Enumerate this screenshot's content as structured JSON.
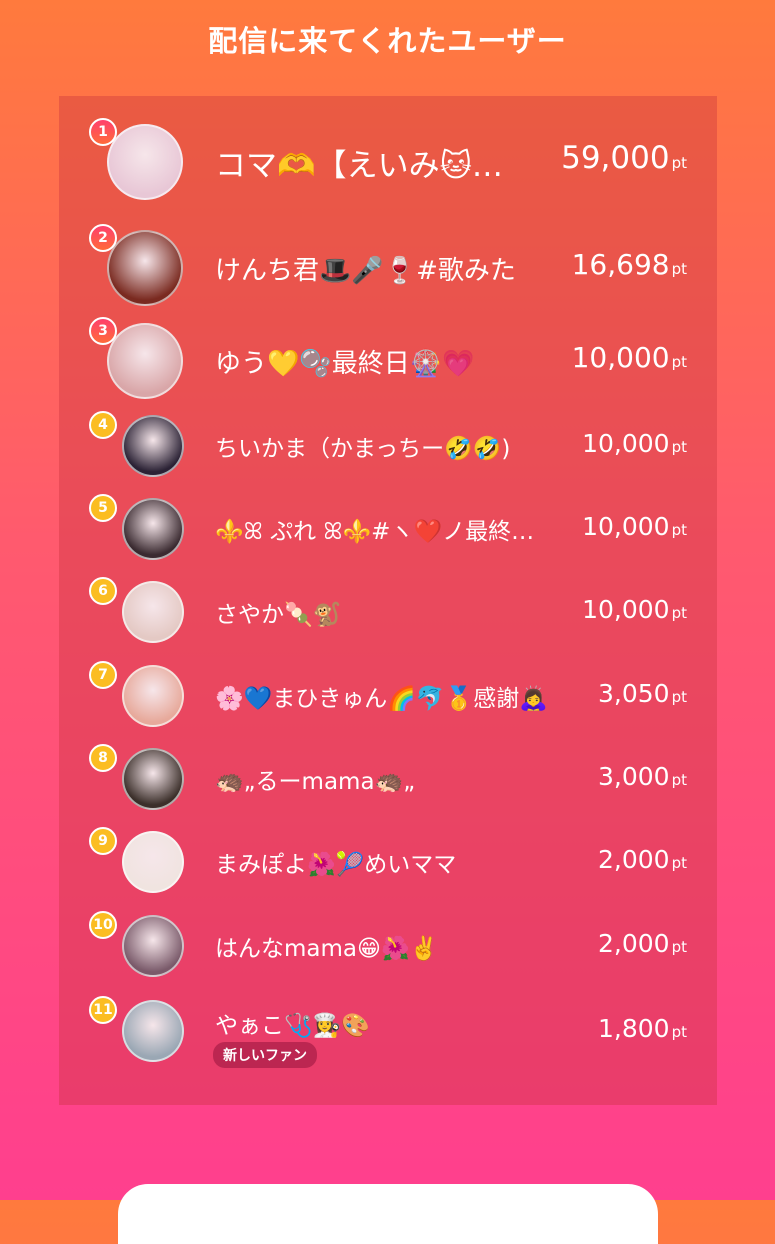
{
  "header": {
    "title": "配信に来てくれたユーザー"
  },
  "users": [
    {
      "rank": "1",
      "name": "コマ🫶【えいみ🐱…",
      "points": "59,000",
      "unit": "pt",
      "avatar_color": "#e8c7d6"
    },
    {
      "rank": "2",
      "name": "けんち君🎩🎤🍷#歌みた",
      "points": "16,698",
      "unit": "pt",
      "avatar_color": "#7a2a20"
    },
    {
      "rank": "3",
      "name": "ゆう💛🫧最終日🎡💗",
      "points": "10,000",
      "unit": "pt",
      "avatar_color": "#d9a6a8"
    },
    {
      "rank": "4",
      "name": "ちいかま（かまっちー🤣🤣)",
      "points": "10,000",
      "unit": "pt",
      "avatar_color": "#2b2235"
    },
    {
      "rank": "5",
      "name": "⚜️ꕤ ぷれ ꕤ⚜️#ヽ❤️ノ最終日🤍",
      "points": "10,000",
      "unit": "pt",
      "avatar_color": "#3a2a30"
    },
    {
      "rank": "6",
      "name": "さやか🍡🐒",
      "points": "10,000",
      "unit": "pt",
      "avatar_color": "#e4c9c4"
    },
    {
      "rank": "7",
      "name": "🌸💙まひきゅん🌈🐬🥇感謝🙇‍♀️",
      "points": "3,050",
      "unit": "pt",
      "avatar_color": "#e7a99b"
    },
    {
      "rank": "8",
      "name": "🦔„るーmama🦔„",
      "points": "3,000",
      "unit": "pt",
      "avatar_color": "#3b2f2a"
    },
    {
      "rank": "9",
      "name": "まみぽよ🌺🎾めいママ",
      "points": "2,000",
      "unit": "pt",
      "avatar_color": "#f0e4e0"
    },
    {
      "rank": "10",
      "name": "はんなmama😁🌺✌️",
      "points": "2,000",
      "unit": "pt",
      "avatar_color": "#7a5a6a"
    },
    {
      "rank": "11",
      "name": "やぁこ🩺👩‍🍳🎨",
      "points": "1,800",
      "unit": "pt",
      "avatar_color": "#9aa7b4",
      "badge": "新しいファン"
    }
  ]
}
